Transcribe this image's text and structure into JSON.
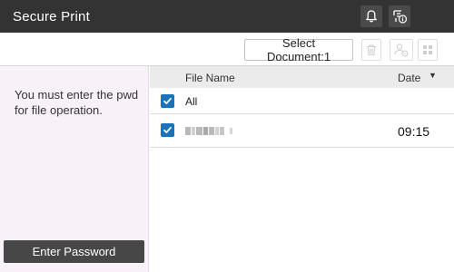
{
  "titlebar": {
    "title": "Secure Print",
    "icons": [
      "bell-icon",
      "job-info-icon"
    ]
  },
  "toolbar": {
    "select_document_label": "Select Document:1",
    "icons": [
      "trash-icon",
      "user-print-icon",
      "grid-view-icon"
    ]
  },
  "left_panel": {
    "message": "You must enter the pwd\nfor file operation.",
    "enter_password_label": "Enter Password"
  },
  "table": {
    "headers": {
      "file_name": "File Name",
      "date": "Date"
    },
    "sort_indicator": "▼",
    "all_row": {
      "label": "All",
      "checked": true
    },
    "rows": [
      {
        "file_name": "",
        "file_name_blurred": true,
        "time": "09:15",
        "checked": true
      }
    ]
  },
  "colors": {
    "titlebar_bg": "#333333",
    "left_panel_bg": "#f8f1f8",
    "checkbox_blue": "#1a73b8",
    "button_dark": "#474747",
    "table_header_bg": "#ebebeb"
  }
}
